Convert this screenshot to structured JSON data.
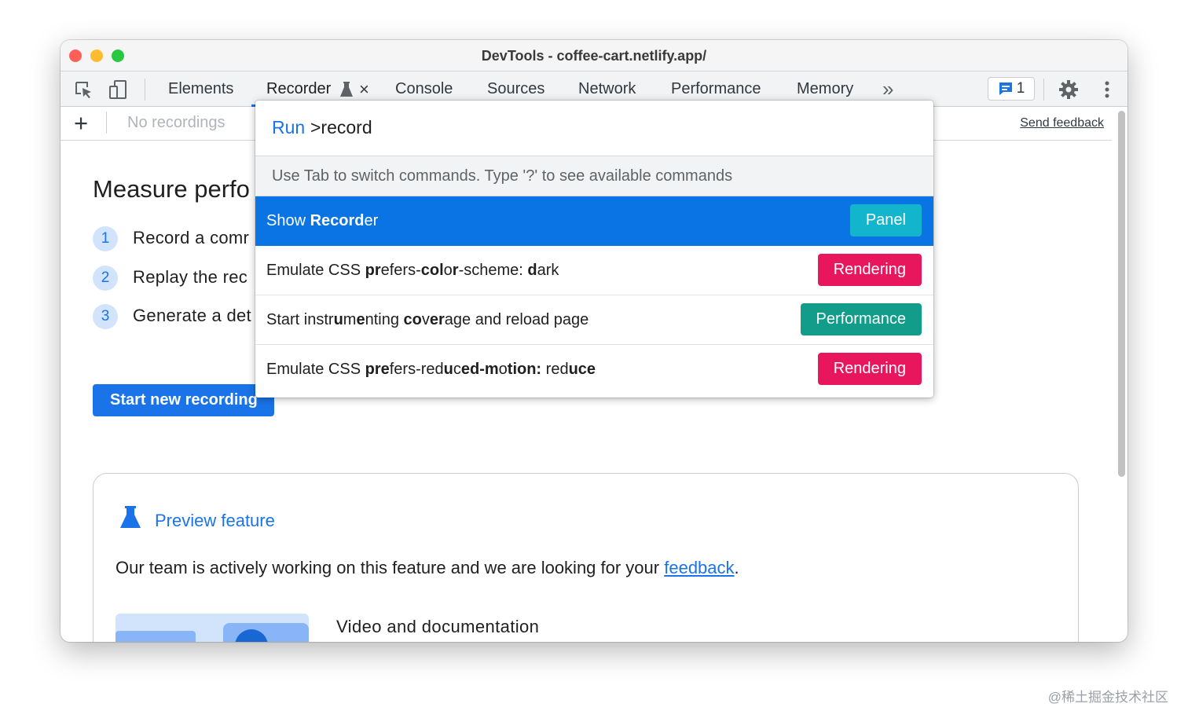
{
  "window": {
    "title": "DevTools - coffee-cart.netlify.app/"
  },
  "toolbar": {
    "tabs": [
      "Elements",
      "Recorder",
      "Console",
      "Sources",
      "Network",
      "Performance",
      "Memory"
    ],
    "active_tab": "Recorder",
    "more_tabs_glyph": "»",
    "close_tab_glyph": "×",
    "issues_count": "1"
  },
  "subbar": {
    "add_glyph": "+",
    "recordings_select": "No recordings",
    "send_feedback": "Send feedback"
  },
  "main": {
    "title": "Measure perfo",
    "steps": [
      {
        "num": "1",
        "text": "Record a comr"
      },
      {
        "num": "2",
        "text": "Replay the rec"
      },
      {
        "num": "3",
        "text": "Generate a det"
      }
    ],
    "start_button": "Start new recording"
  },
  "preview": {
    "title": "Preview feature",
    "body_prefix": "Our team is actively working on this feature and we are looking for your ",
    "body_link": "feedback",
    "body_suffix": ".",
    "video_title": "Video and documentation"
  },
  "palette": {
    "prompt_label": "Run",
    "query": ">record",
    "hint": "Use Tab to switch commands. Type '?' to see available commands",
    "items": [
      {
        "badge": "Panel",
        "badge_color": "#12b5cb",
        "selected": true
      },
      {
        "badge": "Rendering",
        "badge_color": "#e8175d",
        "selected": false
      },
      {
        "badge": "Performance",
        "badge_color": "#129c8a",
        "selected": false
      },
      {
        "badge": "Rendering",
        "badge_color": "#e8175d",
        "selected": false
      }
    ],
    "item_text": {
      "item0": [
        "Show ",
        "Record",
        "er"
      ],
      "item1": [
        "Emulate CSS ",
        "pr",
        "efers-",
        "col",
        "o",
        "r",
        "-scheme: ",
        "d",
        "ark"
      ],
      "item2": [
        "Start instr",
        "u",
        "m",
        "e",
        "nting ",
        "co",
        "v",
        "er",
        "age and reload page"
      ],
      "item3": [
        "Emulate CSS ",
        "pre",
        "fers-red",
        "u",
        "c",
        "ed-m",
        "o",
        "tion: ",
        "red",
        "uce"
      ]
    }
  },
  "colors": {
    "accent": "#1a73e8",
    "selected_row": "#0b74e5",
    "rendering": "#e8175d",
    "performance": "#129c8a",
    "panel": "#12b5cb"
  },
  "watermark": "@稀土掘金技术社区"
}
